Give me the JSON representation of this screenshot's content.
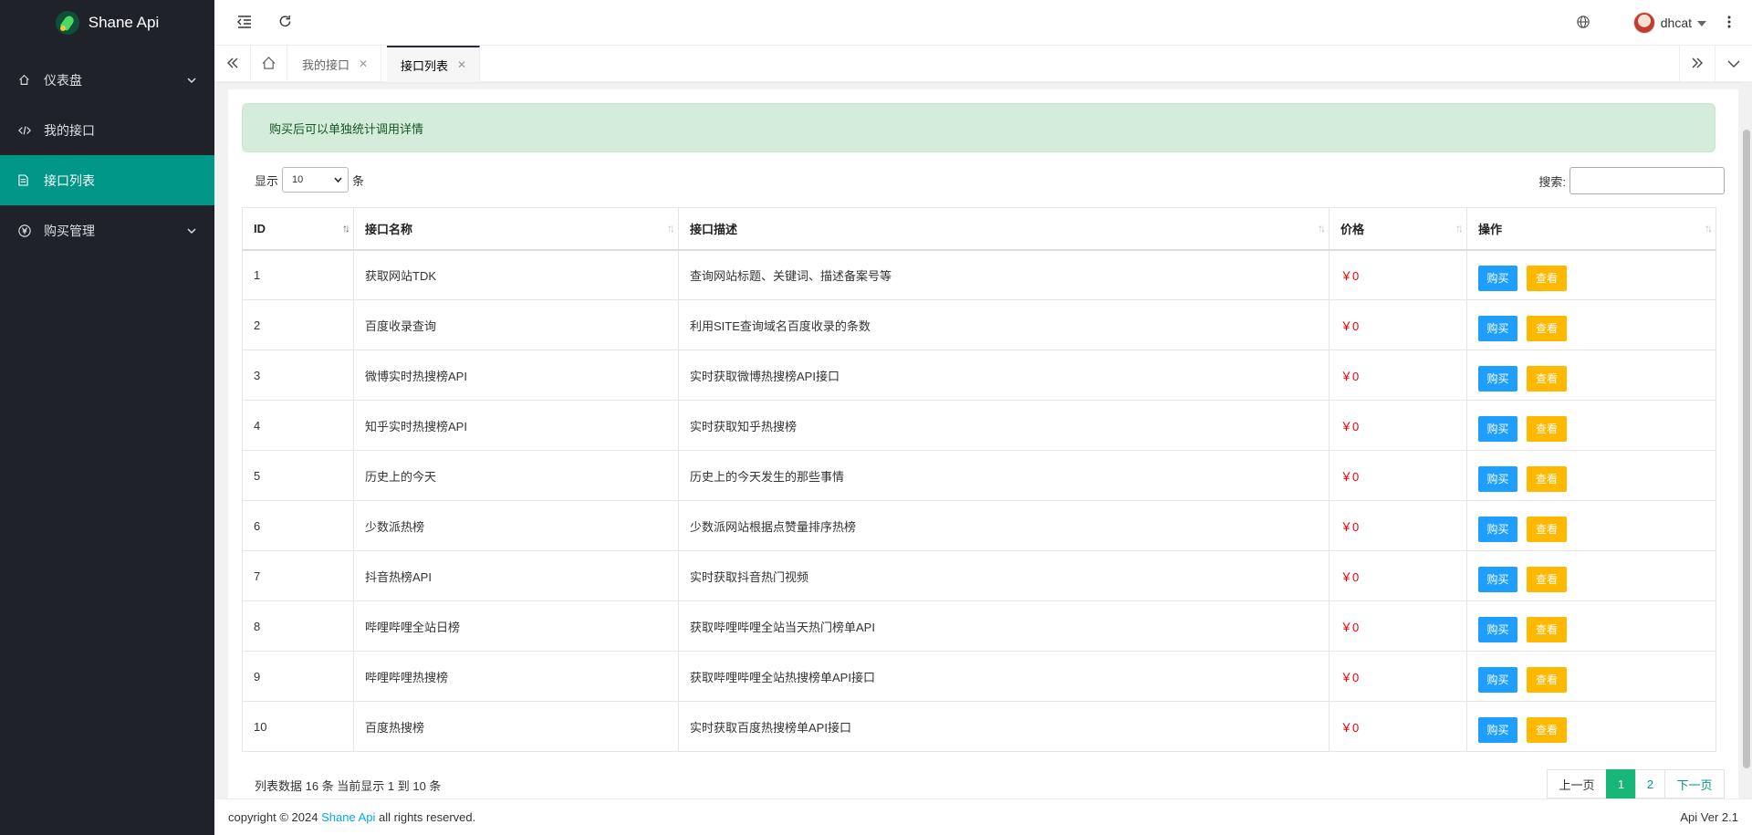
{
  "sidebar": {
    "brand": "Shane Api",
    "items": [
      {
        "label": "仪表盘",
        "icon": "home-icon",
        "expandable": true,
        "active": false
      },
      {
        "label": "我的接口",
        "icon": "code-icon",
        "expandable": false,
        "active": false
      },
      {
        "label": "接口列表",
        "icon": "document-icon",
        "expandable": false,
        "active": true
      },
      {
        "label": "购买管理",
        "icon": "yen-icon",
        "expandable": true,
        "active": false
      }
    ]
  },
  "header": {
    "username": "dhcat"
  },
  "tabs": [
    {
      "label": "我的接口",
      "active": false
    },
    {
      "label": "接口列表",
      "active": true
    }
  ],
  "alert": "购买后可以单独统计调用详情",
  "length": {
    "prefix": "显示",
    "value": "10",
    "suffix": "条"
  },
  "search": {
    "label": "搜索:"
  },
  "table": {
    "columns": [
      "ID",
      "接口名称",
      "接口描述",
      "价格",
      "操作"
    ],
    "buy_label": "购买",
    "view_label": "查看",
    "rows": [
      {
        "id": "1",
        "name": "获取网站TDK",
        "desc": "查询网站标题、关键词、描述备案号等",
        "price": "￥0"
      },
      {
        "id": "2",
        "name": "百度收录查询",
        "desc": "利用SITE查询域名百度收录的条数",
        "price": "￥0"
      },
      {
        "id": "3",
        "name": "微博实时热搜榜API",
        "desc": "实时获取微博热搜榜API接口",
        "price": "￥0"
      },
      {
        "id": "4",
        "name": "知乎实时热搜榜API",
        "desc": "实时获取知乎热搜榜",
        "price": "￥0"
      },
      {
        "id": "5",
        "name": "历史上的今天",
        "desc": "历史上的今天发生的那些事情",
        "price": "￥0"
      },
      {
        "id": "6",
        "name": "少数派热榜",
        "desc": "少数派网站根据点赞量排序热榜",
        "price": "￥0"
      },
      {
        "id": "7",
        "name": "抖音热榜API",
        "desc": "实时获取抖音热门视频",
        "price": "￥0"
      },
      {
        "id": "8",
        "name": "哔哩哔哩全站日榜",
        "desc": "获取哔哩哔哩全站当天热门榜单API",
        "price": "￥0"
      },
      {
        "id": "9",
        "name": "哔哩哔哩热搜榜",
        "desc": "获取哔哩哔哩全站热搜榜单API接口",
        "price": "￥0"
      },
      {
        "id": "10",
        "name": "百度热搜榜",
        "desc": "实时获取百度热搜榜单API接口",
        "price": "￥0"
      }
    ]
  },
  "table_info": "列表数据 16 条 当前显示 1 到 10 条",
  "pagination": {
    "prev": "上一页",
    "pages": [
      "1",
      "2"
    ],
    "current": "1",
    "next": "下一页"
  },
  "footer": {
    "copyright_prefix": "copyright © 2024",
    "brand_link": "Shane Api",
    "copyright_suffix": "all rights reserved.",
    "version": "Api Ver 2.1"
  },
  "colors": {
    "sidebar_bg": "#20222a",
    "active_menu": "#009688",
    "buy_button": "#1e9fff",
    "view_button": "#ffb800",
    "price_text": "#ee0000",
    "pager_current": "#16b777",
    "alert_bg": "#d4edda"
  }
}
